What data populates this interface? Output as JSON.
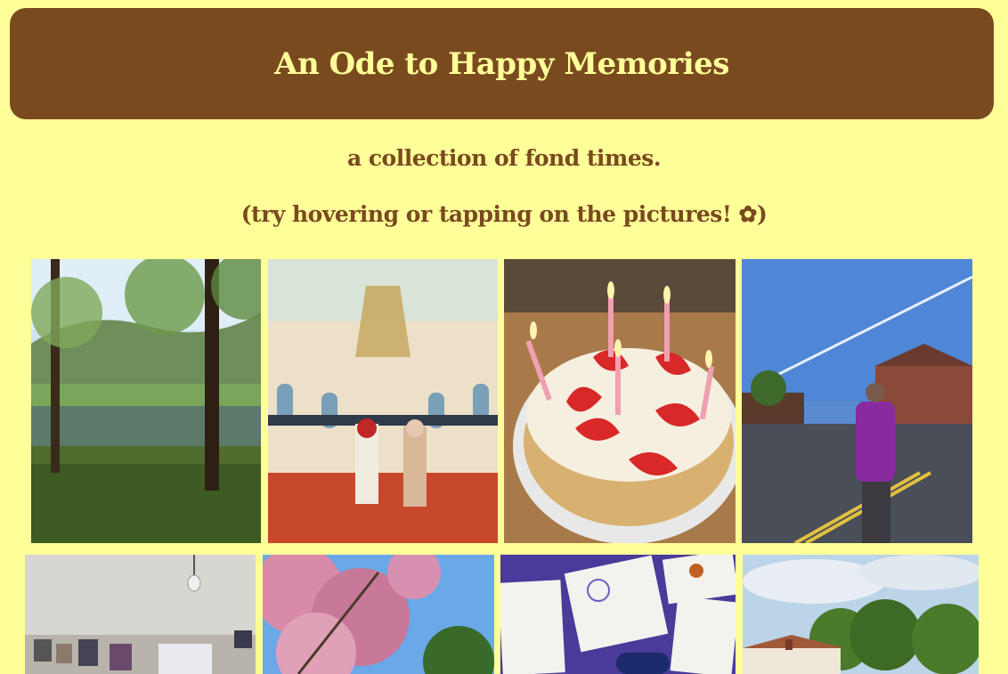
{
  "header": {
    "title": "An Ode to Happy Memories"
  },
  "subtitle": {
    "line1": "a collection of fond times.",
    "line2": "(try hovering or tapping on the pictures! ✿)"
  },
  "colors": {
    "background": "#ffff99",
    "accent": "#7a4a1f"
  }
}
